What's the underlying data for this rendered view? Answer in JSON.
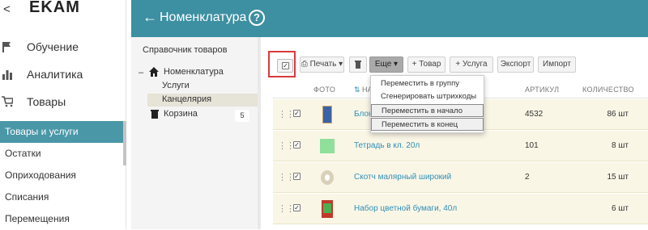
{
  "brand": {
    "back": "<",
    "logo": "EKAM"
  },
  "sidebar": {
    "items": [
      {
        "label": "Обучение",
        "icon": "flag-icon"
      },
      {
        "label": "Аналитика",
        "icon": "bar-chart-icon"
      },
      {
        "label": "Товары",
        "icon": "cart-icon"
      }
    ],
    "sub_items": [
      {
        "label": "Товары и услуги",
        "active": true
      },
      {
        "label": "Остатки"
      },
      {
        "label": "Оприходования"
      },
      {
        "label": "Списания"
      },
      {
        "label": "Перемещения"
      }
    ]
  },
  "header": {
    "title": "Номенклатура",
    "help": "?"
  },
  "catalog": {
    "title": "Справочник товаров",
    "root_toggle": "–",
    "root": "Номенклатура",
    "children": [
      "Услуги",
      "Канцелярия"
    ],
    "trash": {
      "label": "Корзина",
      "count": "5"
    }
  },
  "toolbar": {
    "print": "Печать",
    "more": "Еще",
    "add_product": "+ Товар",
    "add_service": "+ Услуга",
    "export": "Экспорт",
    "import": "Импорт"
  },
  "table": {
    "columns": {
      "photo": "ФОТО",
      "name": "НА",
      "article": "АРТИКУЛ",
      "quantity": "КОЛИЧЕСТВО"
    },
    "rows": [
      {
        "name": "Блокн",
        "article": "4532",
        "quantity": "86 шт"
      },
      {
        "name": "Тетрадь в кл. 20л",
        "article": "101",
        "quantity": "8 шт"
      },
      {
        "name": "Скотч малярный широкий",
        "article": "2",
        "quantity": "15 шт"
      },
      {
        "name": "Набор цветной бумаги, 40л",
        "article": "",
        "quantity": "6 шт"
      }
    ]
  },
  "menu": {
    "items": [
      "Переместить в группу",
      "Сгенерировать штрихкоды",
      "Переместить в начало",
      "Переместить в конец"
    ]
  },
  "colors": {
    "accent": "#3d8fa2",
    "active_nav": "#4a97a8",
    "link": "#2f8fb7",
    "row_bg": "#faf6e6"
  }
}
